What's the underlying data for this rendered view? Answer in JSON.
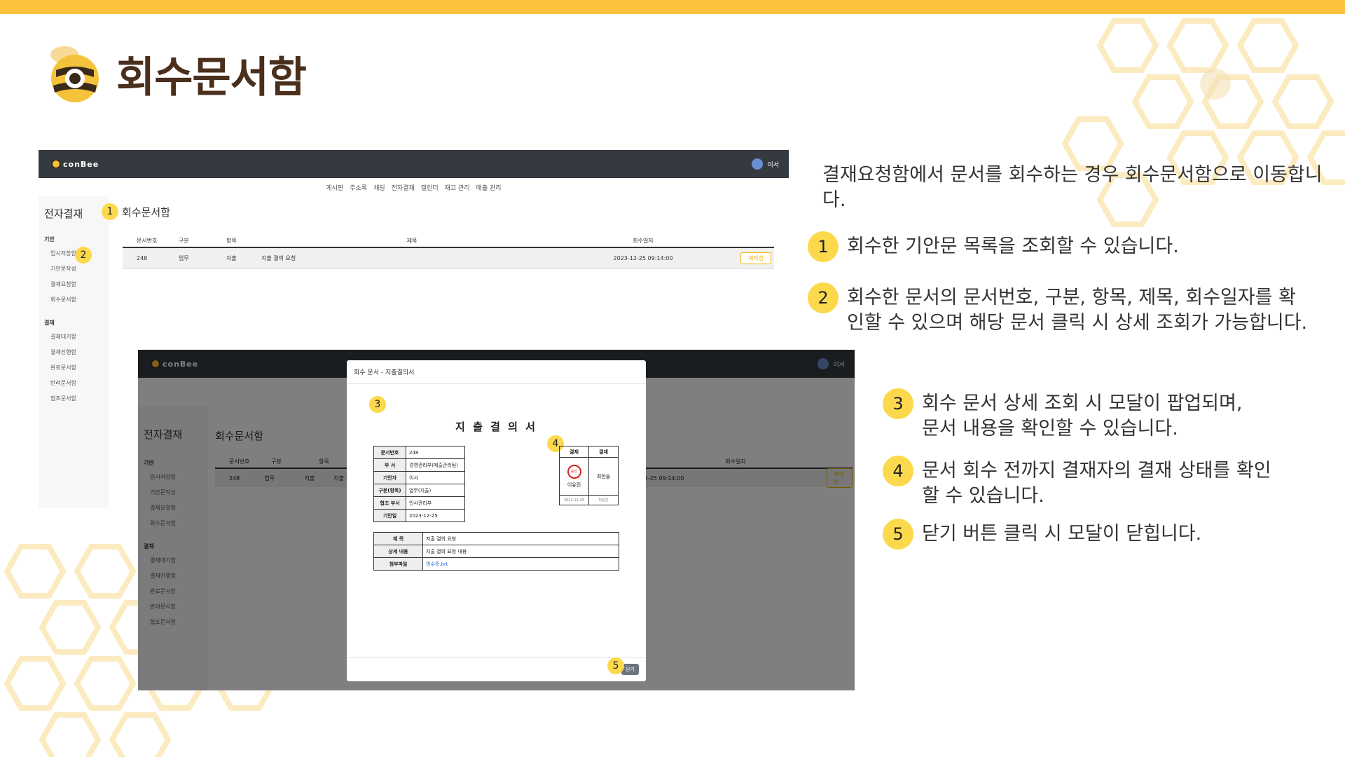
{
  "slide": {
    "title": "회수문서함"
  },
  "app": {
    "logo_text": "conBee",
    "user_name": "이서",
    "menu": [
      "게시판",
      "주소록",
      "채팅",
      "전자결재",
      "캘린더",
      "재고 관리",
      "매출 관리"
    ]
  },
  "sidebar": {
    "heading": "전자결재",
    "group1": "기안",
    "group1_items": [
      "임시저장함",
      "기안문작성",
      "결재요청함",
      "회수문서함"
    ],
    "group2": "결재",
    "group2_items": [
      "결재대기함",
      "결재진행함",
      "완료문서함",
      "반려문서함",
      "협조문서함"
    ]
  },
  "page": {
    "title": "회수문서함"
  },
  "table": {
    "headers": [
      "문서번호",
      "구분",
      "항목",
      "제목",
      "회수일자"
    ],
    "row": {
      "doc_no": "248",
      "type": "업무",
      "category": "지출",
      "title": "지출 결의 요청",
      "date": "2023-12-25 09:14:00",
      "action": "재작성"
    }
  },
  "modal": {
    "header": "회수 문서 - 지출결의서",
    "title": "지 출 결 의 서",
    "info": [
      {
        "k": "문서번호",
        "v": "248"
      },
      {
        "k": "부 서",
        "v": "경영관리부(매출관리팀)"
      },
      {
        "k": "기안자",
        "v": "이서"
      },
      {
        "k": "구분(항목)",
        "v": "업무(지출)"
      },
      {
        "k": "협조 부서",
        "v": "인사관리부"
      },
      {
        "k": "기안일",
        "v": "2023-12-25"
      }
    ],
    "approval": {
      "headers": [
        "결재",
        "결재"
      ],
      "approver1": "이유진",
      "approver1_stamp": "승인",
      "approver1_date": "2023-12-25",
      "approver2": "최한솔",
      "approver2_date": "미승인"
    },
    "body": [
      {
        "k": "제 목",
        "v": "지출 결의 요청"
      },
      {
        "k": "상세 내용",
        "v": "지출 결의 요청 내용"
      },
      {
        "k": "첨부파일",
        "v": "영수증.txt"
      }
    ],
    "close_label": "닫기"
  },
  "badges": {
    "b1": "1",
    "b2": "2",
    "b3": "3",
    "b4": "4",
    "b5": "5"
  },
  "description": {
    "intro": "결재요청함에서 문서를 회수하는 경우 회수문서함으로 이동합니다.",
    "items": [
      {
        "n": "1",
        "text": "회수한 기안문 목록을 조회할 수 있습니다."
      },
      {
        "n": "2",
        "text": "회수한 문서의 문서번호, 구분, 항목, 제목, 회수일자를 확인할 수 있으며 해당 문서 클릭 시 상세 조회가 가능합니다."
      },
      {
        "n": "3",
        "text": "회수 문서 상세 조회 시 모달이 팝업되며, 문서 내용을 확인할 수 있습니다."
      },
      {
        "n": "4",
        "text": "문서 회수 전까지 결재자의 결재 상태를 확인할 수 있습니다."
      },
      {
        "n": "5",
        "text": "닫기 버튼 클릭 시 모달이 닫힙니다."
      }
    ]
  },
  "colors": {
    "accent": "#fcc13d",
    "badge": "#fcd94c",
    "nav": "#343a40",
    "title": "#4a2f1d"
  }
}
